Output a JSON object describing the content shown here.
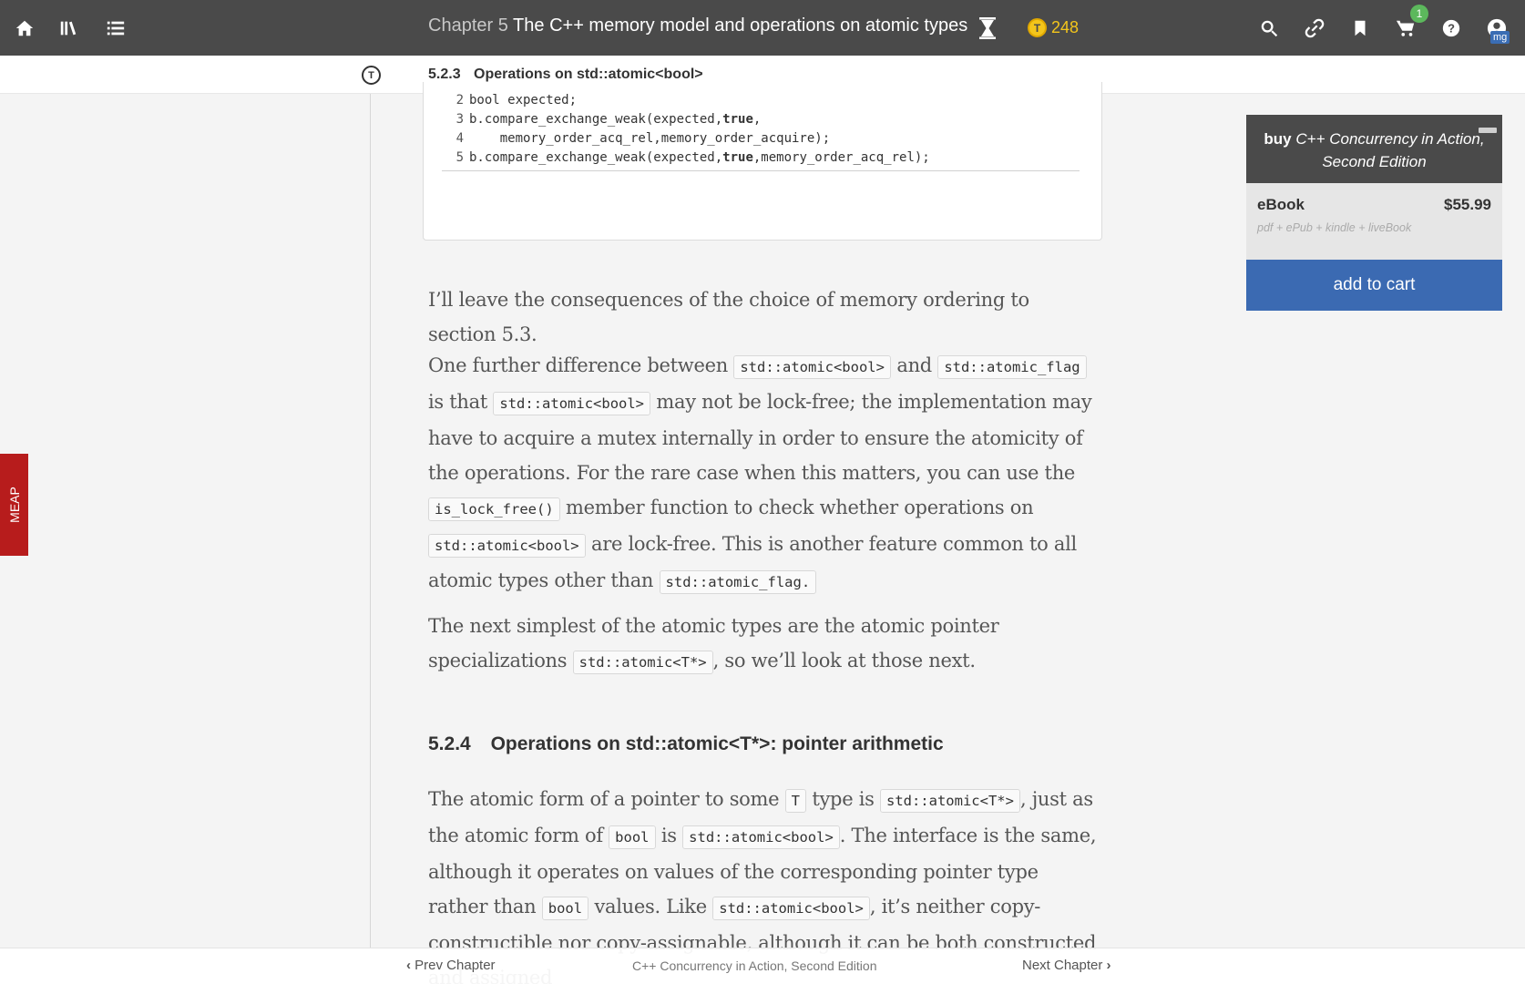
{
  "topbar": {
    "icons": [
      "home-icon",
      "library-icon",
      "toc-list-icon",
      "hourglass-icon",
      "search-icon",
      "link-icon",
      "bookmark-icon",
      "cart-icon",
      "help-icon",
      "account-icon"
    ],
    "chapter_prefix": "Chapter 5",
    "chapter_title": "The C++ memory model and operations on atomic types",
    "token_icon_letter": "T",
    "token_count": "248",
    "cart_count": "1",
    "user_initials": "mg",
    "token_color": "#f3c51b"
  },
  "section_bar": {
    "toggle_letter": "T",
    "number": "5.2.3",
    "title": "Operations on std::atomic<bool>"
  },
  "code": {
    "lines": [
      {
        "n": "2",
        "parts": [
          [
            "bool expected;",
            false
          ]
        ]
      },
      {
        "n": "3",
        "parts": [
          [
            "b.compare_exchange_weak(expected,",
            false
          ],
          [
            "true",
            true
          ],
          [
            ",",
            false
          ]
        ]
      },
      {
        "n": "4",
        "parts": [
          [
            "    memory_order_acq_rel,memory_order_acquire);",
            false
          ]
        ]
      },
      {
        "n": "5",
        "parts": [
          [
            "b.compare_exchange_weak(expected,",
            false
          ],
          [
            "true",
            true
          ],
          [
            ",memory_order_acq_rel);",
            false
          ]
        ]
      }
    ]
  },
  "article": {
    "p1": "I’ll leave the consequences of the choice of memory ordering to section 5.3.",
    "p2": [
      [
        "t",
        "One further difference between "
      ],
      [
        "c",
        "std::atomic<bool>"
      ],
      [
        "t",
        " and "
      ],
      [
        "c",
        "std::atomic_flag"
      ],
      [
        "t",
        " is that "
      ],
      [
        "c",
        "std::atomic<bool>"
      ],
      [
        "t",
        " may not be lock-free; the implementation may have to acquire a mutex internally in order to ensure the atomicity of the operations. For the rare case when this matters, you can use the "
      ],
      [
        "c",
        "is_lock_free()"
      ],
      [
        "t",
        " member function to check whether operations on "
      ],
      [
        "c",
        "std::atomic<bool>"
      ],
      [
        "t",
        " are lock-free. This is another feature common to all atomic types other than "
      ],
      [
        "c",
        "std::atomic_flag."
      ]
    ],
    "p3": [
      [
        "t",
        "The next simplest of the atomic types are the atomic pointer specializations "
      ],
      [
        "c",
        "std::atomic<T*>"
      ],
      [
        "t",
        ", so we’ll look at those next."
      ]
    ],
    "h524_number": "5.2.4",
    "h524_title": "Operations on std::atomic<T*>: pointer arithmetic",
    "p4": [
      [
        "t",
        "The atomic form of a pointer to some "
      ],
      [
        "c",
        "T"
      ],
      [
        "t",
        " type is "
      ],
      [
        "c",
        "std::atomic<T*>"
      ],
      [
        "t",
        ", just as the atomic form of "
      ],
      [
        "c",
        "bool"
      ],
      [
        "t",
        " is "
      ],
      [
        "c",
        "std::atomic<bool>"
      ],
      [
        "t",
        ". The interface is the same, although it operates on values of the corresponding pointer type rather than "
      ],
      [
        "c",
        "bool"
      ],
      [
        "t",
        " values. Like "
      ],
      [
        "c",
        "std::atomic<bool>"
      ],
      [
        "t",
        ", it’s neither copy-constructible nor copy-assignable, although it can be both constructed and assigned"
      ]
    ]
  },
  "buy_box": {
    "buy_word": "buy",
    "book_title": "C++ Concurrency in Action, Second Edition",
    "format_label": "eBook",
    "price": "$55.99",
    "formats": "pdf + ePub + kindle + liveBook",
    "cta": "add to cart"
  },
  "meap_tab": "MEAP",
  "footer": {
    "prev": "Prev Chapter",
    "book_title": "C++ Concurrency in Action, Second Edition",
    "next": "Next Chapter"
  }
}
